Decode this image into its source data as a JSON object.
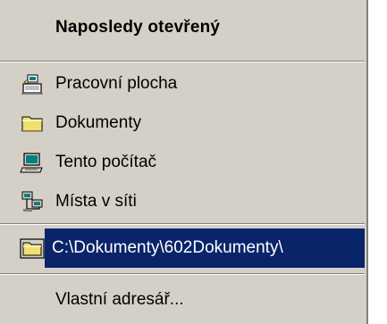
{
  "menu": {
    "header": "Naposledy otevřený",
    "items": [
      {
        "label": "Pracovní plocha",
        "icon": "desktop-icon"
      },
      {
        "label": "Dokumenty",
        "icon": "folder-icon"
      },
      {
        "label": "Tento počítač",
        "icon": "computer-icon"
      },
      {
        "label": "Místa v síti",
        "icon": "network-icon"
      }
    ],
    "recent": {
      "label": "C:\\Dokumenty\\602Dokumenty\\",
      "icon": "folder-icon"
    },
    "custom": {
      "label": "Vlastní adresář..."
    }
  },
  "colors": {
    "menu_bg": "#d4d0c8",
    "selection_bg": "#0a246a",
    "selection_text": "#ffffff",
    "folder_yellow": "#f0e070"
  }
}
